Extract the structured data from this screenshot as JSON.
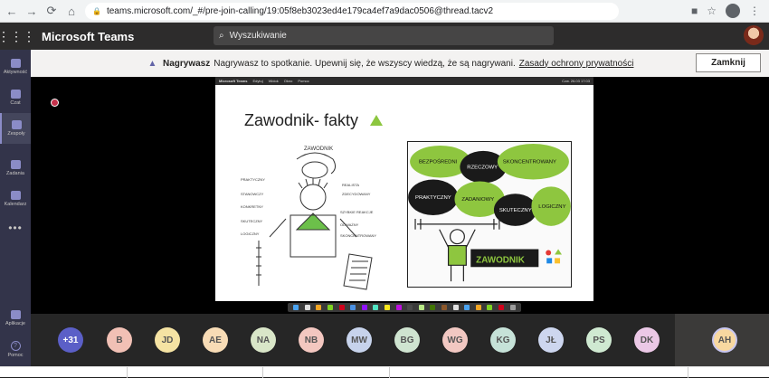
{
  "browser": {
    "url": "teams.microsoft.com/_#/pre-join-calling/19:05f8eb3023ed4e179ca4ef7a9dac0506@thread.tacv2"
  },
  "app": {
    "title": "Microsoft Teams",
    "search_placeholder": "Wyszukiwanie"
  },
  "rail": {
    "items": [
      {
        "label": "Aktywność",
        "icon": "bell-icon"
      },
      {
        "label": "Czat",
        "icon": "chat-icon"
      },
      {
        "label": "Zespoły",
        "icon": "teams-icon"
      },
      {
        "label": "Zadania",
        "icon": "tasks-icon"
      },
      {
        "label": "Kalendarz",
        "icon": "calendar-icon"
      }
    ],
    "more": "•••",
    "apps_label": "Aplikacje",
    "help_label": "Pomoc"
  },
  "banner": {
    "bold": "Nagrywasz",
    "message": "Nagrywasz to spotkanie. Upewnij się, że wszyscy wiedzą, że są nagrywani.",
    "link": "Zasady ochrony prywatności",
    "close_label": "Zamknij"
  },
  "shared_screen": {
    "menu": [
      "Microsoft Teams",
      "Edytuj",
      "Widok",
      "Okno",
      "Pomoc"
    ],
    "clock": "Czw. 26.03  17:03",
    "slide_title": "Zawodnik- fakty",
    "sketch_badge": "ZAWODNIK",
    "sketch_labels_left": [
      "ZAWODNIK",
      "PRAKTYCZNY",
      "KONKRETNY",
      "REALISTA",
      "SKUTECZNY",
      "LOGICZNY",
      "ZDECYDOWANY",
      "SZYBKIE REAKCJE",
      "ODWAŻNY",
      "SKONCENTROWANY",
      "STANOWCZY"
    ],
    "sketch_clouds": [
      "BEZPOŚREDNI",
      "RZECZOWY",
      "SKONCENTROWANY",
      "PRAKTYCZNY",
      "ZADANIOWY",
      "SKUTECZNY",
      "LOGICZNY"
    ]
  },
  "participants": {
    "count_label": "+31",
    "people": [
      {
        "initials": "B",
        "color": "#f1c0b5"
      },
      {
        "initials": "JD",
        "color": "#f5e3a3"
      },
      {
        "initials": "AE",
        "color": "#f8dcb6"
      },
      {
        "initials": "NA",
        "color": "#d9e6c8"
      },
      {
        "initials": "NB",
        "color": "#f3c7c0"
      },
      {
        "initials": "MW",
        "color": "#c7d3ec"
      },
      {
        "initials": "BG",
        "color": "#cfe4d0"
      },
      {
        "initials": "WG",
        "color": "#f2c8c2"
      },
      {
        "initials": "KG",
        "color": "#c6e2d8"
      },
      {
        "initials": "JŁ",
        "color": "#cdd6ef"
      },
      {
        "initials": "PS",
        "color": "#cfe9d1"
      },
      {
        "initials": "DK",
        "color": "#ebc8e6"
      }
    ],
    "self": {
      "initials": "AH",
      "color": "#f8d8a0"
    }
  },
  "colors": {
    "teams_purple": "#6264a7",
    "recording_red": "#c4314b",
    "slide_green": "#8cc63f"
  }
}
